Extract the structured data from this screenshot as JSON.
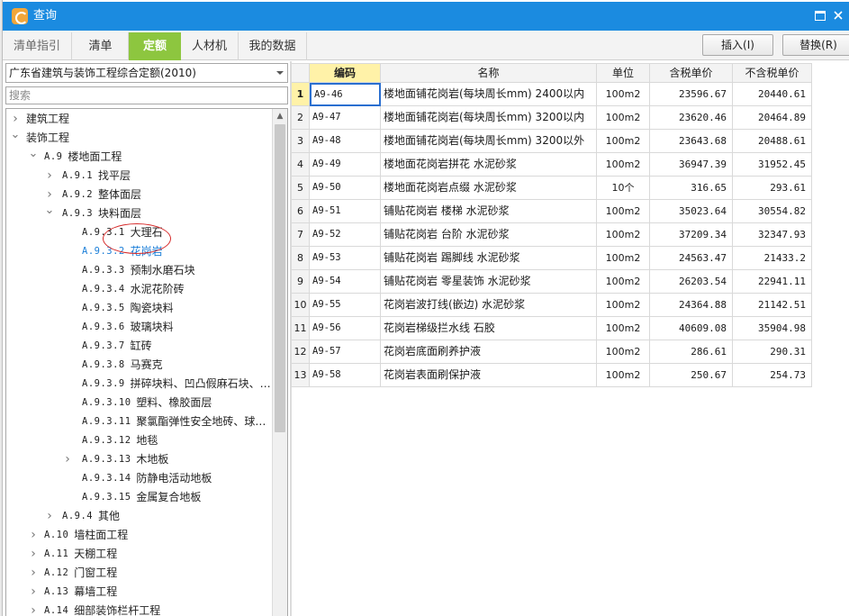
{
  "window": {
    "title": "查询"
  },
  "tabs": [
    {
      "label": "清单指引",
      "active": false
    },
    {
      "label": "清单",
      "active": false
    },
    {
      "label": "定额",
      "active": true
    },
    {
      "label": "人材机",
      "active": false
    },
    {
      "label": "我的数据",
      "active": false
    }
  ],
  "toolbar": {
    "insert_label": "插入(I)",
    "replace_label": "替换(R)"
  },
  "library": {
    "selected": "广东省建筑与装饰工程综合定额(2010)"
  },
  "search": {
    "placeholder": "搜索"
  },
  "tree": [
    {
      "code": "",
      "name": "建筑工程",
      "level": 0,
      "toggle": "collapsed"
    },
    {
      "code": "",
      "name": "装饰工程",
      "level": 0,
      "toggle": "expanded"
    },
    {
      "code": "A.9",
      "name": "楼地面工程",
      "level": 1,
      "toggle": "expanded"
    },
    {
      "code": "A.9.1",
      "name": "找平层",
      "level": 2,
      "toggle": "collapsed"
    },
    {
      "code": "A.9.2",
      "name": "整体面层",
      "level": 2,
      "toggle": "collapsed"
    },
    {
      "code": "A.9.3",
      "name": "块料面层",
      "level": 2,
      "toggle": "expanded"
    },
    {
      "code": "A.9.3.1",
      "name": "大理石",
      "level": 3,
      "toggle": "none"
    },
    {
      "code": "A.9.3.2",
      "name": "花岗岩",
      "level": 3,
      "toggle": "none",
      "selected": true
    },
    {
      "code": "A.9.3.3",
      "name": "预制水磨石块",
      "level": 3,
      "toggle": "none"
    },
    {
      "code": "A.9.3.4",
      "name": "水泥花阶砖",
      "level": 3,
      "toggle": "none"
    },
    {
      "code": "A.9.3.5",
      "name": "陶瓷块料",
      "level": 3,
      "toggle": "none"
    },
    {
      "code": "A.9.3.6",
      "name": "玻璃块料",
      "level": 3,
      "toggle": "none"
    },
    {
      "code": "A.9.3.7",
      "name": "缸砖",
      "level": 3,
      "toggle": "none"
    },
    {
      "code": "A.9.3.8",
      "name": "马赛克",
      "level": 3,
      "toggle": "none"
    },
    {
      "code": "A.9.3.9",
      "name": "拼碎块料、凹凸假麻石块、…",
      "level": 3,
      "toggle": "none"
    },
    {
      "code": "A.9.3.10",
      "name": "塑料、橡胶面层",
      "level": 3,
      "toggle": "none"
    },
    {
      "code": "A.9.3.11",
      "name": "聚氯酯弹性安全地砖、球…",
      "level": 3,
      "toggle": "none"
    },
    {
      "code": "A.9.3.12",
      "name": "地毯",
      "level": 3,
      "toggle": "none"
    },
    {
      "code": "A.9.3.13",
      "name": "木地板",
      "level": 3,
      "toggle": "collapsed"
    },
    {
      "code": "A.9.3.14",
      "name": "防静电活动地板",
      "level": 3,
      "toggle": "none"
    },
    {
      "code": "A.9.3.15",
      "name": "金属复合地板",
      "level": 3,
      "toggle": "none"
    },
    {
      "code": "A.9.4",
      "name": "其他",
      "level": 2,
      "toggle": "collapsed"
    },
    {
      "code": "A.10",
      "name": "墙柱面工程",
      "level": 1,
      "toggle": "collapsed"
    },
    {
      "code": "A.11",
      "name": "天棚工程",
      "level": 1,
      "toggle": "collapsed"
    },
    {
      "code": "A.12",
      "name": "门窗工程",
      "level": 1,
      "toggle": "collapsed"
    },
    {
      "code": "A.13",
      "name": "幕墙工程",
      "level": 1,
      "toggle": "collapsed"
    },
    {
      "code": "A.14",
      "name": "细部装饰栏杆工程",
      "level": 1,
      "toggle": "collapsed"
    }
  ],
  "grid": {
    "columns": {
      "code": "编码",
      "name": "名称",
      "unit": "单位",
      "tax_price": "含税单价",
      "notax_price": "不含税单价"
    },
    "rows": [
      {
        "num": "1",
        "code": "A9-46",
        "name": "楼地面铺花岗岩(每块周长mm) 2400以内",
        "unit": "100m2",
        "tax_price": "23596.67",
        "notax_price": "20440.61"
      },
      {
        "num": "2",
        "code": "A9-47",
        "name": "楼地面铺花岗岩(每块周长mm) 3200以内",
        "unit": "100m2",
        "tax_price": "23620.46",
        "notax_price": "20464.89"
      },
      {
        "num": "3",
        "code": "A9-48",
        "name": "楼地面铺花岗岩(每块周长mm) 3200以外",
        "unit": "100m2",
        "tax_price": "23643.68",
        "notax_price": "20488.61"
      },
      {
        "num": "4",
        "code": "A9-49",
        "name": "楼地面花岗岩拼花 水泥砂浆",
        "unit": "100m2",
        "tax_price": "36947.39",
        "notax_price": "31952.45"
      },
      {
        "num": "5",
        "code": "A9-50",
        "name": "楼地面花岗岩点缀 水泥砂浆",
        "unit": "10个",
        "tax_price": "316.65",
        "notax_price": "293.61"
      },
      {
        "num": "6",
        "code": "A9-51",
        "name": "铺贴花岗岩 楼梯 水泥砂浆",
        "unit": "100m2",
        "tax_price": "35023.64",
        "notax_price": "30554.82"
      },
      {
        "num": "7",
        "code": "A9-52",
        "name": "铺贴花岗岩 台阶 水泥砂浆",
        "unit": "100m2",
        "tax_price": "37209.34",
        "notax_price": "32347.93"
      },
      {
        "num": "8",
        "code": "A9-53",
        "name": "铺贴花岗岩 踢脚线 水泥砂浆",
        "unit": "100m2",
        "tax_price": "24563.47",
        "notax_price": "21433.2"
      },
      {
        "num": "9",
        "code": "A9-54",
        "name": "铺贴花岗岩 零星装饰 水泥砂浆",
        "unit": "100m2",
        "tax_price": "26203.54",
        "notax_price": "22941.11"
      },
      {
        "num": "10",
        "code": "A9-55",
        "name": "花岗岩波打线(嵌边) 水泥砂浆",
        "unit": "100m2",
        "tax_price": "24364.88",
        "notax_price": "21142.51"
      },
      {
        "num": "11",
        "code": "A9-56",
        "name": "花岗岩梯级拦水线 石胶",
        "unit": "100m2",
        "tax_price": "40609.08",
        "notax_price": "35904.98"
      },
      {
        "num": "12",
        "code": "A9-57",
        "name": "花岗岩底面刷养护液",
        "unit": "100m2",
        "tax_price": "286.61",
        "notax_price": "290.31"
      },
      {
        "num": "13",
        "code": "A9-58",
        "name": "花岗岩表面刷保护液",
        "unit": "100m2",
        "tax_price": "250.67",
        "notax_price": "254.73"
      }
    ]
  },
  "colors": {
    "title_bar": "#1b8be0",
    "active_tab": "#8dc63f",
    "selected_tree_item": "#1c7fd8",
    "annotation_circle": "#d62b2b",
    "current_row_header": "#fff2a8"
  },
  "icons": {
    "app": "app-logo-icon",
    "maximize": "maximize-icon",
    "close": "close-icon",
    "expand": "chevron-right-icon",
    "collapse": "chevron-down-icon"
  }
}
